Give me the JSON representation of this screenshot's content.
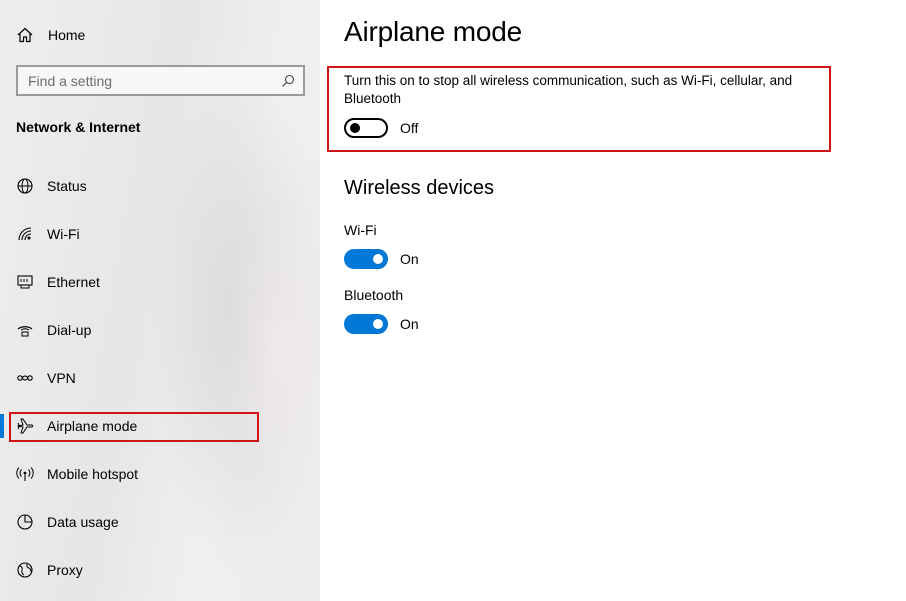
{
  "sidebar": {
    "home_label": "Home",
    "search_placeholder": "Find a setting",
    "section_title": "Network & Internet",
    "items": [
      {
        "label": "Status",
        "icon": "globe-icon"
      },
      {
        "label": "Wi-Fi",
        "icon": "wifi-icon"
      },
      {
        "label": "Ethernet",
        "icon": "ethernet-icon"
      },
      {
        "label": "Dial-up",
        "icon": "dialup-icon"
      },
      {
        "label": "VPN",
        "icon": "vpn-icon"
      },
      {
        "label": "Airplane mode",
        "icon": "airplane-icon",
        "selected": true
      },
      {
        "label": "Mobile hotspot",
        "icon": "hotspot-icon"
      },
      {
        "label": "Data usage",
        "icon": "data-usage-icon"
      },
      {
        "label": "Proxy",
        "icon": "proxy-icon"
      }
    ]
  },
  "main": {
    "title": "Airplane mode",
    "airplane": {
      "description": "Turn this on to stop all wireless communication, such as Wi-Fi, cellular, and Bluetooth",
      "state_label": "Off",
      "is_on": false
    },
    "wireless_section_title": "Wireless devices",
    "devices": [
      {
        "label": "Wi-Fi",
        "state_label": "On",
        "is_on": true
      },
      {
        "label": "Bluetooth",
        "state_label": "On",
        "is_on": true
      }
    ]
  },
  "colors": {
    "accent": "#0078d7",
    "highlight_border": "#d11515"
  }
}
